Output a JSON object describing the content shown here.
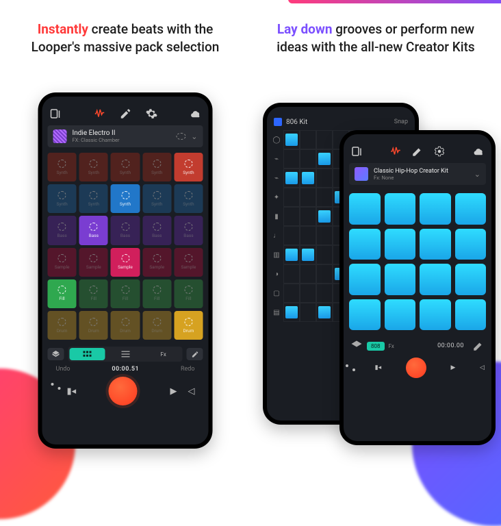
{
  "left": {
    "headline_accent": "Instantly",
    "headline_rest": " create beats with the Looper's massive pack selection",
    "pack_title": "Indie Electro II",
    "pack_subtitle": "FX: Classic Chamber",
    "pad_rows": [
      {
        "label": "Synth",
        "color": "#c23c2f",
        "active_col": 4
      },
      {
        "label": "Synth",
        "color": "#2177c9",
        "active_col": 2
      },
      {
        "label": "Bass",
        "color": "#7a3dd1",
        "active_col": 1
      },
      {
        "label": "Sample",
        "color": "#d11f5c",
        "active_col": 2
      },
      {
        "label": "Fill",
        "color": "#2fa84f",
        "active_col": 0
      },
      {
        "label": "Drum",
        "color": "#d6a221",
        "active_col": 4
      }
    ],
    "transport": {
      "undo": "Undo",
      "redo": "Redo",
      "time": "00:00.51",
      "fx_label": "Fx"
    }
  },
  "right": {
    "headline_accent": "Lay down",
    "headline_rest": " grooves or perform new ideas with the all-new Creator Kits",
    "seq": {
      "kit_name": "806 Kit",
      "snap_label": "Snap",
      "row_icons": [
        "◯",
        "⌁",
        "⌁",
        "✦",
        "▮",
        "♩",
        "▥",
        "◑",
        "▢",
        "▤"
      ],
      "on_cells": [
        [
          0,
          0
        ],
        [
          0,
          4
        ],
        [
          1,
          2
        ],
        [
          1,
          5
        ],
        [
          2,
          0
        ],
        [
          2,
          1
        ],
        [
          3,
          3
        ],
        [
          4,
          2
        ],
        [
          4,
          6
        ],
        [
          5,
          4
        ],
        [
          6,
          0
        ],
        [
          6,
          1
        ],
        [
          7,
          3
        ],
        [
          8,
          5
        ],
        [
          9,
          0
        ],
        [
          9,
          2
        ]
      ]
    },
    "kit": {
      "pack_title": "Classic Hip-Hop Creator Kit",
      "pack_subtitle": "Fx: None",
      "transport": {
        "label": "808",
        "fx": "Fx",
        "time": "00:00.00"
      }
    }
  }
}
